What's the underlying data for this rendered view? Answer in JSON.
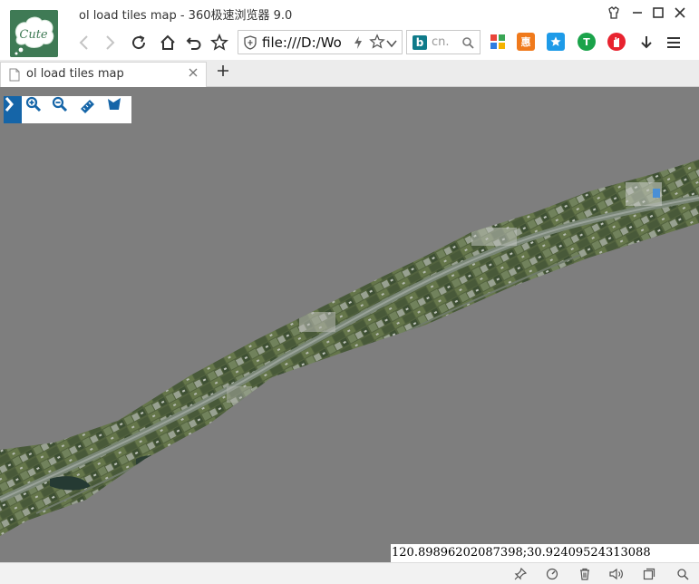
{
  "window": {
    "title": "ol load tiles map - 360极速浏览器 9.0",
    "logo_text": "Cute"
  },
  "navbar": {
    "url": "file:///D:/Wo",
    "search_placeholder": "cn."
  },
  "extensions": [
    {
      "name": "apps-grid-icon",
      "color": "#e9453a"
    },
    {
      "name": "shopping-icon",
      "color": "#f07a1c",
      "glyph": "惠"
    },
    {
      "name": "star-favorite-icon",
      "color": "#1e9be8"
    },
    {
      "name": "shield-t-icon",
      "color": "#1aa34a",
      "glyph": "T"
    },
    {
      "name": "adblock-icon",
      "color": "#e8232f"
    }
  ],
  "tabs": [
    {
      "label": "ol load tiles map"
    }
  ],
  "map": {
    "background": "#7e7e7e",
    "accent": "#1565a8",
    "coordinates": "120.89896202087398;30.92409524313088",
    "toolbar": [
      {
        "name": "toggle-panel-button",
        "icon": "chevron-right-icon"
      },
      {
        "name": "zoom-in-button",
        "icon": "zoom-in-icon"
      },
      {
        "name": "zoom-out-button",
        "icon": "zoom-out-icon"
      },
      {
        "name": "measure-button",
        "icon": "ruler-icon"
      },
      {
        "name": "area-button",
        "icon": "area-icon"
      }
    ]
  }
}
